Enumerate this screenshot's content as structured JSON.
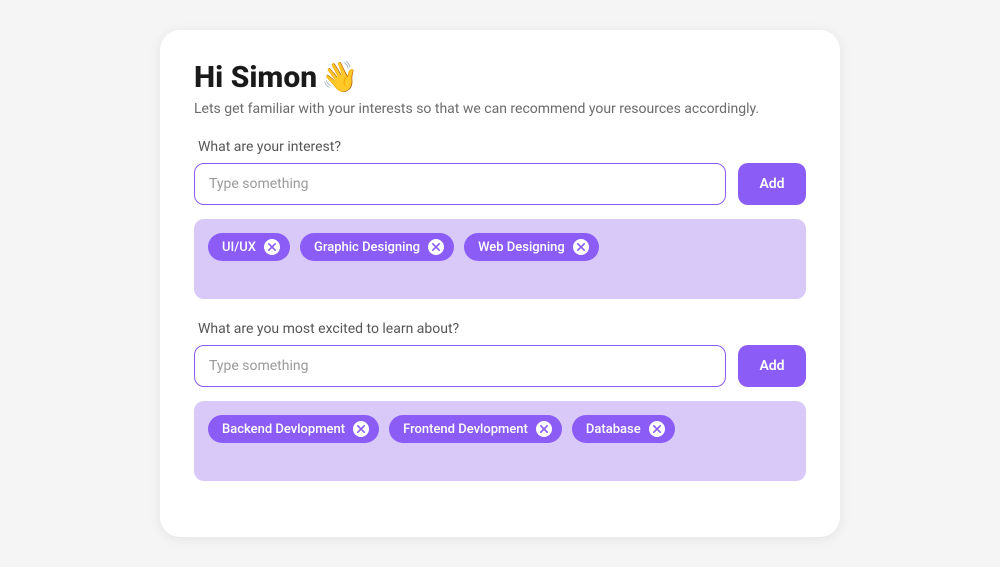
{
  "header": {
    "title": "Hi Simon",
    "wave_emoji": "👋",
    "subtitle": "Lets get familiar with your interests so that we can recommend your resources accordingly."
  },
  "interests": {
    "label": "What are your interest?",
    "placeholder": "Type something",
    "add_label": "Add",
    "tags": [
      {
        "label": "UI/UX"
      },
      {
        "label": "Graphic Designing"
      },
      {
        "label": "Web Designing"
      }
    ]
  },
  "learning": {
    "label": "What are you most excited to learn about?",
    "placeholder": "Type something",
    "add_label": "Add",
    "tags": [
      {
        "label": "Backend Devlopment"
      },
      {
        "label": "Frontend Devlopment"
      },
      {
        "label": "Database"
      }
    ]
  }
}
